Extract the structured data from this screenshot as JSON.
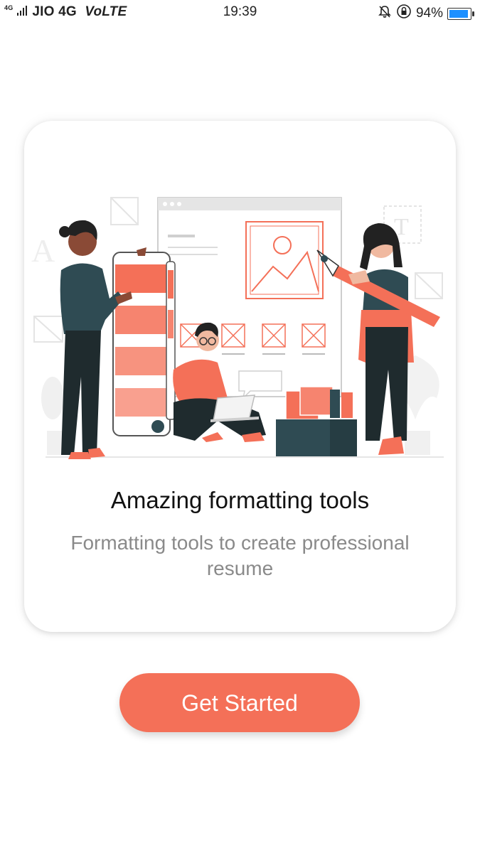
{
  "status_bar": {
    "carrier_prefix": "4G",
    "carrier": "JIO 4G",
    "volte": "VoLTE",
    "time": "19:39",
    "battery": "94%",
    "battery_level": 0.94,
    "icons": [
      "signal-icon",
      "mute-bell-icon",
      "rotation-lock-icon",
      "battery-icon"
    ]
  },
  "onboarding": {
    "title": "Amazing formatting tools",
    "subtitle": "Formatting tools to create professional resume",
    "illustration": "people-editing-resume-illustration"
  },
  "cta": {
    "label": "Get Started"
  },
  "colors": {
    "accent": "#f47058",
    "dark": "#2f4b53",
    "text": "#111111",
    "muted": "#8a8a8a"
  }
}
